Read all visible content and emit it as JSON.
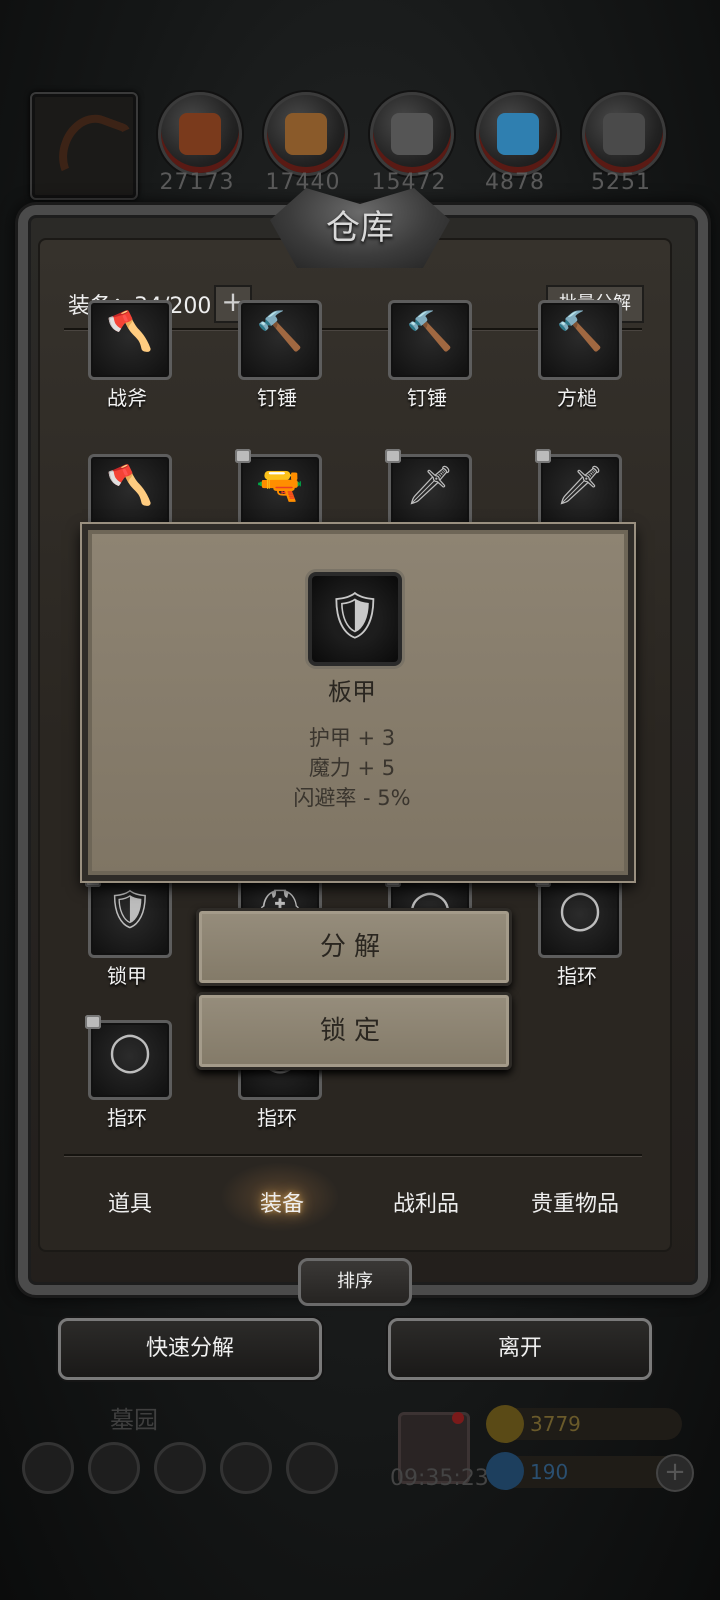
{
  "resources": [
    {
      "name": "wood-log-icon",
      "value": "27173",
      "color": "#7a3a1c"
    },
    {
      "name": "plank-icon",
      "value": "17440",
      "color": "#8a5a2a"
    },
    {
      "name": "iron-ingot-icon",
      "value": "15472",
      "color": "#555555"
    },
    {
      "name": "crystal-icon",
      "value": "4878",
      "color": "#2f7fb0"
    },
    {
      "name": "stone-icon",
      "value": "5251",
      "color": "#4a4a4a"
    }
  ],
  "warehouse": {
    "title": "仓库",
    "equip_count": "装备：34/200",
    "plus_label": "+",
    "batch_label": "批量分解"
  },
  "items": [
    {
      "label": "战斧",
      "icon": "battle-axe-icon",
      "glyph": "🪓",
      "locked": false
    },
    {
      "label": "钉锤",
      "icon": "spiked-mace-icon",
      "glyph": "🔨",
      "locked": false
    },
    {
      "label": "钉锤",
      "icon": "spiked-mace-icon",
      "glyph": "🔨",
      "locked": false
    },
    {
      "label": "方槌",
      "icon": "square-hammer-icon",
      "glyph": "🔨",
      "locked": false
    },
    {
      "label": "",
      "icon": "axe-icon",
      "glyph": "🪓",
      "locked": false
    },
    {
      "label": "",
      "icon": "pistol-icon",
      "glyph": "🔫",
      "locked": true
    },
    {
      "label": "",
      "icon": "scimitar-icon",
      "glyph": "🗡",
      "locked": true
    },
    {
      "label": "",
      "icon": "scimitar-icon",
      "glyph": "🗡",
      "locked": true
    },
    {
      "label": "锁甲",
      "icon": "chainmail-icon",
      "glyph": "🛡",
      "locked": true
    },
    {
      "label": "",
      "icon": "helmet-icon",
      "glyph": "⛑",
      "locked": false
    },
    {
      "label": "",
      "icon": "ring-icon",
      "glyph": "◯",
      "locked": true
    },
    {
      "label": "指环",
      "icon": "ring-icon",
      "glyph": "◯",
      "locked": true
    },
    {
      "label": "指环",
      "icon": "ring-icon",
      "glyph": "◯",
      "locked": true
    },
    {
      "label": "指环",
      "icon": "ring-icon",
      "glyph": "◯",
      "locked": false
    }
  ],
  "popup": {
    "name": "板甲",
    "icon": "plate-armor-icon",
    "glyph": "🛡",
    "stats": [
      "护甲 + 3",
      "魔力 + 5",
      "闪避率 - 5%"
    ]
  },
  "actions": {
    "decompose": "分解",
    "lock": "锁定"
  },
  "tabs": [
    "道具",
    "装备",
    "战利品",
    "贵重物品"
  ],
  "active_tab": "装备",
  "sort_label": "排序",
  "quick_decompose": "快速分解",
  "leave": "离开",
  "hud": {
    "location": "墓园",
    "timer": "09:35:23",
    "gold": "3779",
    "gems": "190",
    "gold_color": "#8a6a1a",
    "gem_color": "#1f5a8a"
  }
}
